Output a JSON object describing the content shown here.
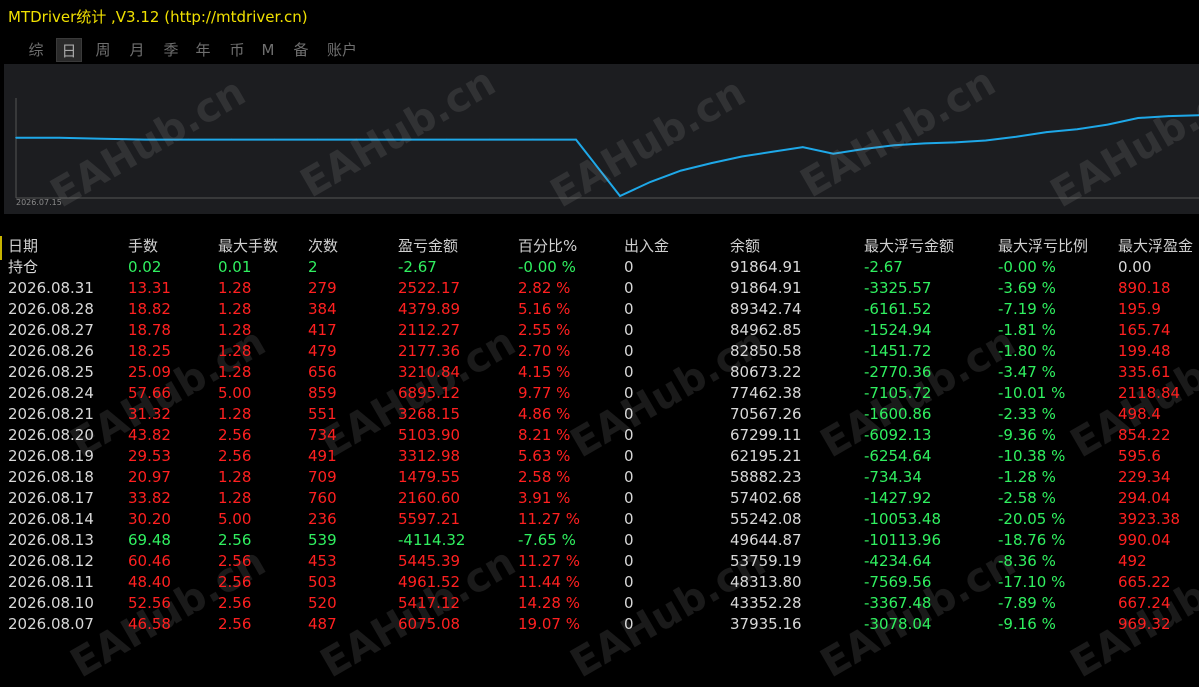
{
  "window": {
    "title": "MTDriver统计 ,V3.12 (http://mtdriver.cn)"
  },
  "tabs": [
    {
      "label": "综",
      "active": false
    },
    {
      "label": "日",
      "active": true
    },
    {
      "label": "周",
      "active": false
    },
    {
      "label": "月",
      "active": false
    },
    {
      "label": "季",
      "active": false
    },
    {
      "label": "年",
      "active": false
    },
    {
      "label": "币",
      "active": false
    },
    {
      "label": "M",
      "active": false
    },
    {
      "label": "备",
      "active": false
    },
    {
      "label": "账户",
      "active": false
    }
  ],
  "chart": {
    "start_date_label": "2026.07.15",
    "line_color": "#1ea8e8",
    "watermark": "EAHub.cn"
  },
  "chart_data": {
    "type": "line",
    "x_label": "2026.07.15",
    "series": [
      {
        "values": [
          0.62,
          0.62,
          0.61,
          0.6,
          0.6,
          0.6,
          0.6,
          0.6,
          0.6,
          0.6,
          0.6,
          0.6,
          0.6,
          0.6,
          0.0,
          0.15,
          0.27,
          0.35,
          0.42,
          0.47,
          0.52,
          0.45,
          0.5,
          0.54,
          0.56,
          0.57,
          0.59,
          0.63,
          0.68,
          0.71,
          0.76,
          0.83,
          0.85,
          0.86
        ]
      }
    ]
  },
  "colors": {
    "profit": "#ff2020",
    "loss": "#30f060",
    "neutral": "#d8d8d8",
    "title": "#f0e000"
  },
  "table": {
    "headers": [
      "日期",
      "手数",
      "最大手数",
      "次数",
      "盈亏金额",
      "百分比%",
      "出入金",
      "余额",
      "最大浮亏金额",
      "最大浮亏比例",
      "最大浮盈金"
    ],
    "rows": [
      {
        "c": [
          "持仓",
          "0.02",
          "0.01",
          "2",
          "-2.67",
          "-0.00 %",
          "0",
          "91864.91",
          "-2.67",
          "-0.00 %",
          "0.00"
        ],
        "tone": "hold"
      },
      {
        "c": [
          "2026.08.31",
          "13.31",
          "1.28",
          "279",
          "2522.17",
          "2.82 %",
          "0",
          "91864.91",
          "-3325.57",
          "-3.69 %",
          "890.18"
        ],
        "tone": "profit"
      },
      {
        "c": [
          "2026.08.28",
          "18.82",
          "1.28",
          "384",
          "4379.89",
          "5.16 %",
          "0",
          "89342.74",
          "-6161.52",
          "-7.19 %",
          "195.9"
        ],
        "tone": "profit"
      },
      {
        "c": [
          "2026.08.27",
          "18.78",
          "1.28",
          "417",
          "2112.27",
          "2.55 %",
          "0",
          "84962.85",
          "-1524.94",
          "-1.81 %",
          "165.74"
        ],
        "tone": "profit"
      },
      {
        "c": [
          "2026.08.26",
          "18.25",
          "1.28",
          "479",
          "2177.36",
          "2.70 %",
          "0",
          "82850.58",
          "-1451.72",
          "-1.80 %",
          "199.48"
        ],
        "tone": "profit"
      },
      {
        "c": [
          "2026.08.25",
          "25.09",
          "1.28",
          "656",
          "3210.84",
          "4.15 %",
          "0",
          "80673.22",
          "-2770.36",
          "-3.47 %",
          "335.61"
        ],
        "tone": "profit"
      },
      {
        "c": [
          "2026.08.24",
          "57.66",
          "5.00",
          "859",
          "6895.12",
          "9.77 %",
          "0",
          "77462.38",
          "-7105.72",
          "-10.01 %",
          "2118.84"
        ],
        "tone": "profit"
      },
      {
        "c": [
          "2026.08.21",
          "31.32",
          "1.28",
          "551",
          "3268.15",
          "4.86 %",
          "0",
          "70567.26",
          "-1600.86",
          "-2.33 %",
          "498.4"
        ],
        "tone": "profit"
      },
      {
        "c": [
          "2026.08.20",
          "43.82",
          "2.56",
          "734",
          "5103.90",
          "8.21 %",
          "0",
          "67299.11",
          "-6092.13",
          "-9.36 %",
          "854.22"
        ],
        "tone": "profit"
      },
      {
        "c": [
          "2026.08.19",
          "29.53",
          "2.56",
          "491",
          "3312.98",
          "5.63 %",
          "0",
          "62195.21",
          "-6254.64",
          "-10.38 %",
          "595.6"
        ],
        "tone": "profit"
      },
      {
        "c": [
          "2026.08.18",
          "20.97",
          "1.28",
          "709",
          "1479.55",
          "2.58 %",
          "0",
          "58882.23",
          "-734.34",
          "-1.28 %",
          "229.34"
        ],
        "tone": "profit"
      },
      {
        "c": [
          "2026.08.17",
          "33.82",
          "1.28",
          "760",
          "2160.60",
          "3.91 %",
          "0",
          "57402.68",
          "-1427.92",
          "-2.58 %",
          "294.04"
        ],
        "tone": "profit"
      },
      {
        "c": [
          "2026.08.14",
          "30.20",
          "5.00",
          "236",
          "5597.21",
          "11.27 %",
          "0",
          "55242.08",
          "-10053.48",
          "-20.05 %",
          "3923.38"
        ],
        "tone": "profit"
      },
      {
        "c": [
          "2026.08.13",
          "69.48",
          "2.56",
          "539",
          "-4114.32",
          "-7.65 %",
          "0",
          "49644.87",
          "-10113.96",
          "-18.76 %",
          "990.04"
        ],
        "tone": "loss"
      },
      {
        "c": [
          "2026.08.12",
          "60.46",
          "2.56",
          "453",
          "5445.39",
          "11.27 %",
          "0",
          "53759.19",
          "-4234.64",
          "-8.36 %",
          "492"
        ],
        "tone": "profit"
      },
      {
        "c": [
          "2026.08.11",
          "48.40",
          "2.56",
          "503",
          "4961.52",
          "11.44 %",
          "0",
          "48313.80",
          "-7569.56",
          "-17.10 %",
          "665.22"
        ],
        "tone": "profit"
      },
      {
        "c": [
          "2026.08.10",
          "52.56",
          "2.56",
          "520",
          "5417.12",
          "14.28 %",
          "0",
          "43352.28",
          "-3367.48",
          "-7.89 %",
          "667.24"
        ],
        "tone": "profit"
      },
      {
        "c": [
          "2026.08.07",
          "46.58",
          "2.56",
          "487",
          "6075.08",
          "19.07 %",
          "0",
          "37935.16",
          "-3078.04",
          "-9.16 %",
          "969.32"
        ],
        "tone": "profit"
      }
    ]
  }
}
